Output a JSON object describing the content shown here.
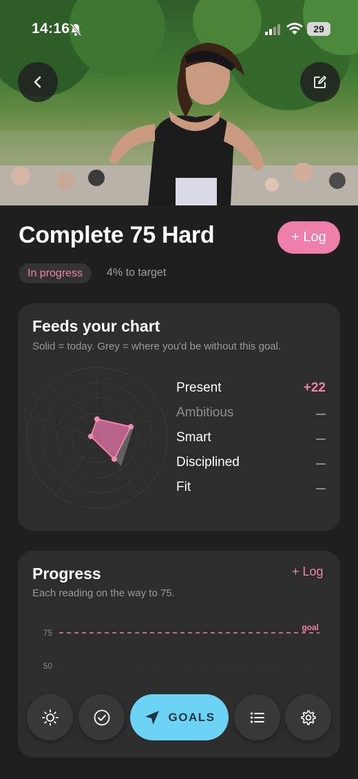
{
  "status_bar": {
    "time": "14:16",
    "battery": "29"
  },
  "goal": {
    "title": "Complete 75 Hard",
    "log_label": "+ Log",
    "status": "In progress",
    "target_text": "4% to target"
  },
  "feeds_card": {
    "title": "Feeds your chart",
    "subtitle": "Solid = today. Grey = where you'd be without this goal.",
    "metrics": [
      {
        "label": "Present",
        "value": "+22"
      },
      {
        "label": "Ambitious",
        "value": ""
      },
      {
        "label": "Smart",
        "value": ""
      },
      {
        "label": "Disciplined",
        "value": ""
      },
      {
        "label": "Fit",
        "value": ""
      }
    ]
  },
  "progress_card": {
    "title": "Progress",
    "log_label": "+ Log",
    "subtitle": "Each reading on the way to 75.",
    "goal_label": "goal",
    "y_ticks": [
      "75",
      "50"
    ]
  },
  "nav": {
    "goals_label": "GOALS"
  },
  "colors": {
    "accent_pink": "#ee7eaa",
    "goals_blue": "#6dd3f5",
    "card_bg": "#2d2d2d",
    "page_bg": "#1f1f1f"
  },
  "icons": [
    "bell-off-icon",
    "signal-icon",
    "wifi-icon",
    "battery-icon",
    "back-chevron-icon",
    "edit-icon",
    "sun-icon",
    "check-circle-icon",
    "navigation-arrow-icon",
    "list-icon",
    "gear-icon"
  ]
}
